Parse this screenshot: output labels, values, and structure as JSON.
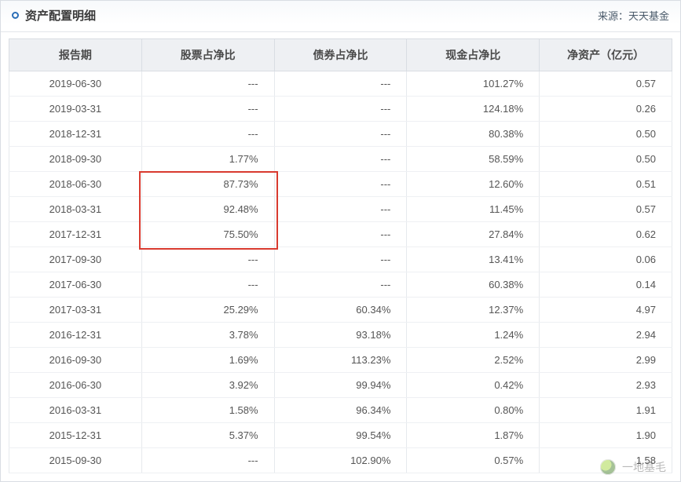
{
  "header": {
    "title": "资产配置明细",
    "source_label": "来源：",
    "source_value": "天天基金"
  },
  "table": {
    "columns": [
      "报告期",
      "股票占净比",
      "债券占净比",
      "现金占净比",
      "净资产（亿元）"
    ],
    "rows": [
      {
        "period": "2019-06-30",
        "stock": "---",
        "bond": "---",
        "cash": "101.27%",
        "nav": "0.57"
      },
      {
        "period": "2019-03-31",
        "stock": "---",
        "bond": "---",
        "cash": "124.18%",
        "nav": "0.26"
      },
      {
        "period": "2018-12-31",
        "stock": "---",
        "bond": "---",
        "cash": "80.38%",
        "nav": "0.50"
      },
      {
        "period": "2018-09-30",
        "stock": "1.77%",
        "bond": "---",
        "cash": "58.59%",
        "nav": "0.50"
      },
      {
        "period": "2018-06-30",
        "stock": "87.73%",
        "bond": "---",
        "cash": "12.60%",
        "nav": "0.51"
      },
      {
        "period": "2018-03-31",
        "stock": "92.48%",
        "bond": "---",
        "cash": "11.45%",
        "nav": "0.57"
      },
      {
        "period": "2017-12-31",
        "stock": "75.50%",
        "bond": "---",
        "cash": "27.84%",
        "nav": "0.62"
      },
      {
        "period": "2017-09-30",
        "stock": "---",
        "bond": "---",
        "cash": "13.41%",
        "nav": "0.06"
      },
      {
        "period": "2017-06-30",
        "stock": "---",
        "bond": "---",
        "cash": "60.38%",
        "nav": "0.14"
      },
      {
        "period": "2017-03-31",
        "stock": "25.29%",
        "bond": "60.34%",
        "cash": "12.37%",
        "nav": "4.97"
      },
      {
        "period": "2016-12-31",
        "stock": "3.78%",
        "bond": "93.18%",
        "cash": "1.24%",
        "nav": "2.94"
      },
      {
        "period": "2016-09-30",
        "stock": "1.69%",
        "bond": "113.23%",
        "cash": "2.52%",
        "nav": "2.99"
      },
      {
        "period": "2016-06-30",
        "stock": "3.92%",
        "bond": "99.94%",
        "cash": "0.42%",
        "nav": "2.93"
      },
      {
        "period": "2016-03-31",
        "stock": "1.58%",
        "bond": "96.34%",
        "cash": "0.80%",
        "nav": "1.91"
      },
      {
        "period": "2015-12-31",
        "stock": "5.37%",
        "bond": "99.54%",
        "cash": "1.87%",
        "nav": "1.90"
      },
      {
        "period": "2015-09-30",
        "stock": "---",
        "bond": "102.90%",
        "cash": "0.57%",
        "nav": "1.58"
      }
    ]
  },
  "highlight": {
    "column_index": 1,
    "row_start": 4,
    "row_end": 6
  },
  "watermark": {
    "text": "一地基毛"
  },
  "chart_data": {
    "type": "table",
    "title": "资产配置明细",
    "columns": [
      "报告期",
      "股票占净比",
      "债券占净比",
      "现金占净比",
      "净资产（亿元）"
    ],
    "rows": [
      [
        "2019-06-30",
        null,
        null,
        101.27,
        0.57
      ],
      [
        "2019-03-31",
        null,
        null,
        124.18,
        0.26
      ],
      [
        "2018-12-31",
        null,
        null,
        80.38,
        0.5
      ],
      [
        "2018-09-30",
        1.77,
        null,
        58.59,
        0.5
      ],
      [
        "2018-06-30",
        87.73,
        null,
        12.6,
        0.51
      ],
      [
        "2018-03-31",
        92.48,
        null,
        11.45,
        0.57
      ],
      [
        "2017-12-31",
        75.5,
        null,
        27.84,
        0.62
      ],
      [
        "2017-09-30",
        null,
        null,
        13.41,
        0.06
      ],
      [
        "2017-06-30",
        null,
        null,
        60.38,
        0.14
      ],
      [
        "2017-03-31",
        25.29,
        60.34,
        12.37,
        4.97
      ],
      [
        "2016-12-31",
        3.78,
        93.18,
        1.24,
        2.94
      ],
      [
        "2016-09-30",
        1.69,
        113.23,
        2.52,
        2.99
      ],
      [
        "2016-06-30",
        3.92,
        99.94,
        0.42,
        2.93
      ],
      [
        "2016-03-31",
        1.58,
        96.34,
        0.8,
        1.91
      ],
      [
        "2015-12-31",
        5.37,
        99.54,
        1.87,
        1.9
      ],
      [
        "2015-09-30",
        null,
        102.9,
        0.57,
        1.58
      ]
    ],
    "units": {
      "股票占净比": "%",
      "债券占净比": "%",
      "现金占净比": "%",
      "净资产（亿元）": "亿元"
    }
  }
}
